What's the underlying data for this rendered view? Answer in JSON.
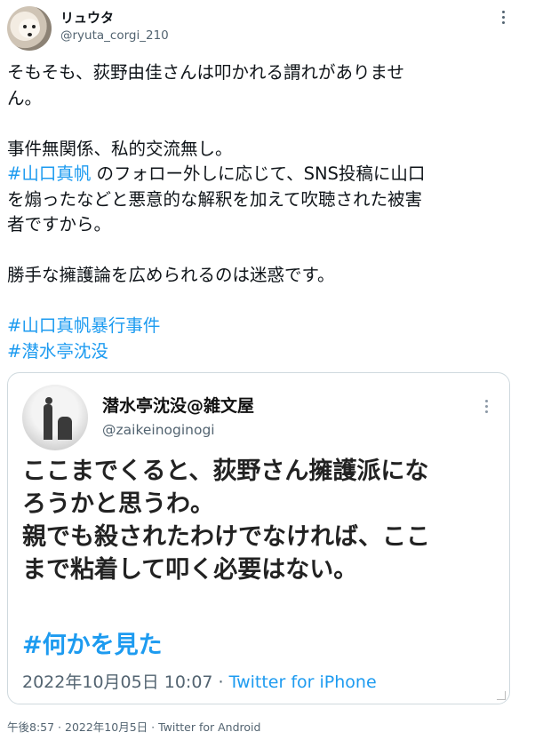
{
  "user": {
    "display_name": "リュウタ",
    "handle": "@ryuta_corgi_210"
  },
  "tweet": {
    "lines": [
      "そもそも、荻野由佳さんは叩かれる謂れがありませ",
      "ん。",
      "",
      "事件無関係、私的交流無し。"
    ],
    "line5_hashtag": "#山口真帆",
    "line5_rest": " のフォロー外しに応じて、SNS投稿に山口",
    "lines2": [
      "を煽ったなどと悪意的な解釈を加えて吹聴された被害",
      "者ですから。",
      "",
      "勝手な擁護論を広められるのは迷惑です。",
      ""
    ],
    "hashtags": [
      "#山口真帆暴行事件",
      "#潜水亭沈没"
    ]
  },
  "quoted": {
    "display_name": "潜水亭沈没@雑文屋",
    "handle": "@zaikeinoginogi",
    "lines": [
      "ここまでくると、荻野さん擁護派にな",
      "ろうかと思うわ。",
      "親でも殺されたわけでなければ、ここ",
      "まで粘着して叩く必要はない。"
    ],
    "hashtag": "#何かを見た",
    "timestamp": "2022年10月05日 10:07 · ",
    "source": "Twitter for iPhone"
  },
  "footer": {
    "meta": "午後8:57 · 2022年10月5日 · Twitter for Android"
  },
  "colors": {
    "link": "#1d9bf0",
    "secondary_text": "#536471",
    "border": "#cfd9de"
  },
  "icons": {
    "more": "more-horizontal-icon",
    "quoted_more": "more-vertical-icon"
  }
}
